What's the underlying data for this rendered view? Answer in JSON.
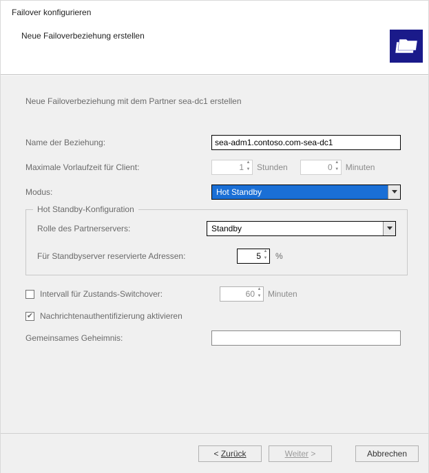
{
  "header": {
    "title": "Failover konfigurieren",
    "subtitle": "Neue Failoverbeziehung erstellen"
  },
  "body": {
    "heading": "Neue Failoverbeziehung mit dem Partner sea-dc1 erstellen",
    "name_label": "Name der Beziehung:",
    "name_value": "sea-adm1.contoso.com-sea-dc1",
    "lead_label": "Maximale Vorlaufzeit für Client:",
    "lead_hours_value": "1",
    "lead_hours_unit": "Stunden",
    "lead_minutes_value": "0",
    "lead_minutes_unit": "Minuten",
    "mode_label": "Modus:",
    "mode_value": "Hot Standby",
    "group_title": "Hot Standby-Konfiguration",
    "role_label": "Rolle des Partnerservers:",
    "role_value": "Standby",
    "reserved_label": "Für Standbyserver reservierte Adressen:",
    "reserved_value": "5",
    "reserved_unit": "%",
    "switchover_label": "Intervall für Zustands-Switchover:",
    "switchover_value": "60",
    "switchover_unit": "Minuten",
    "msgauth_label": "Nachrichtenauthentifizierung aktivieren",
    "secret_label": "Gemeinsames Geheimnis:",
    "secret_value": ""
  },
  "footer": {
    "back": "Zurück",
    "next": "Weiter",
    "cancel": "Abbrechen"
  },
  "state": {
    "switchover_checked": false,
    "msgauth_checked": true
  }
}
